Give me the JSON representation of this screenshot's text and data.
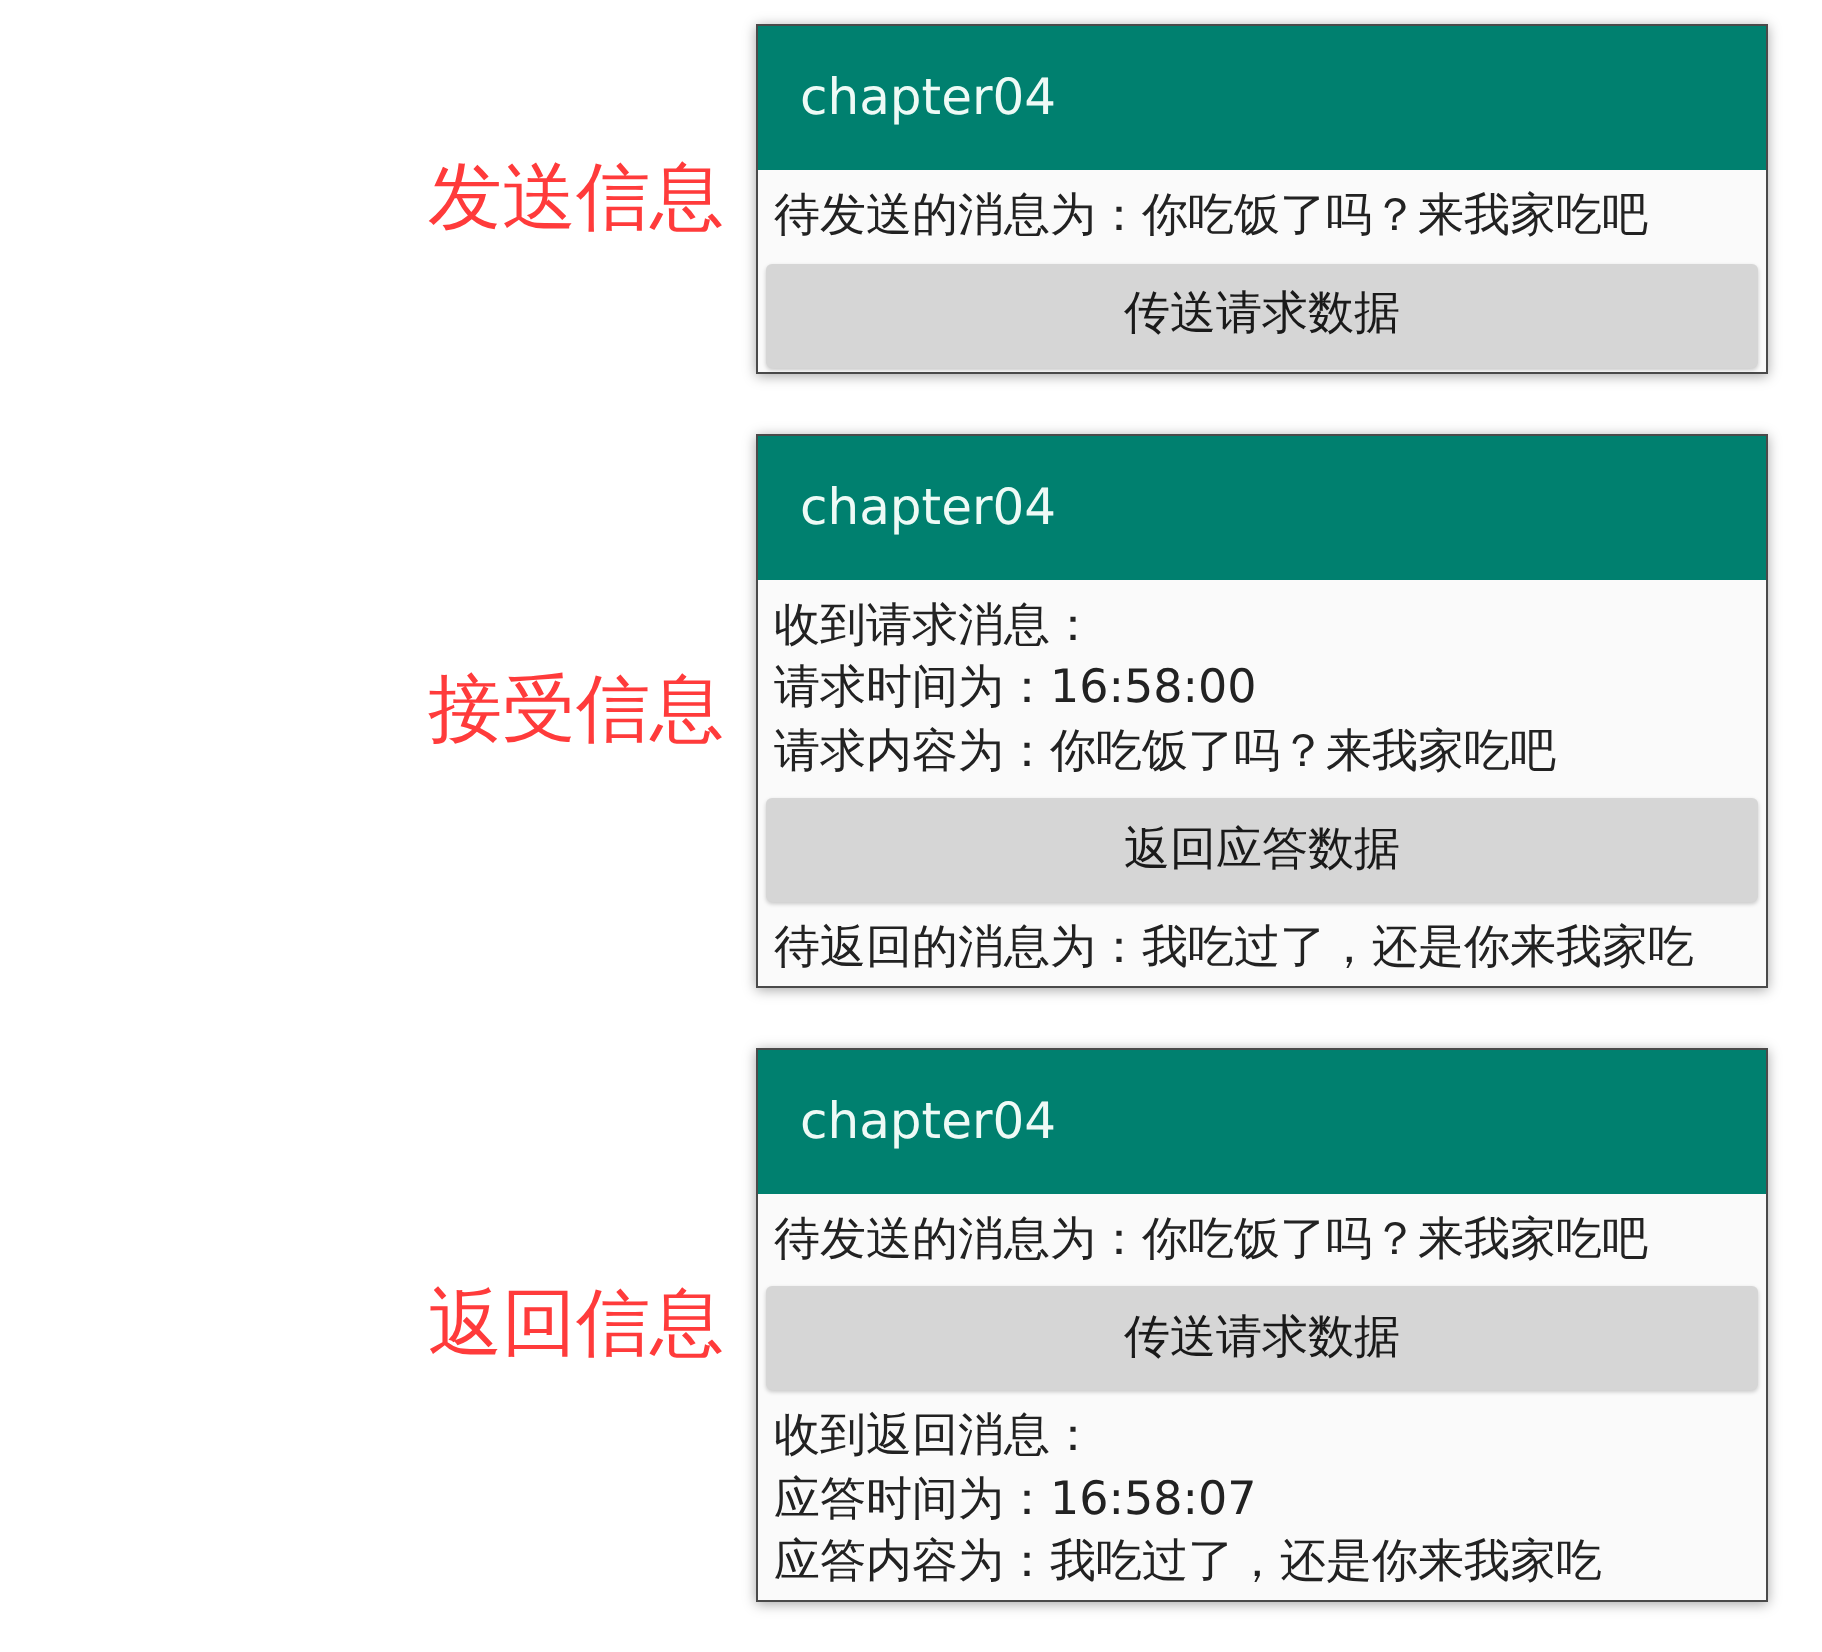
{
  "sections": [
    {
      "label": "发送信息",
      "screen": {
        "title": "chapter04",
        "items": [
          {
            "kind": "text",
            "text": "待发送的消息为：你吃饭了吗？来我家吃吧"
          },
          {
            "kind": "button",
            "text": "传送请求数据"
          }
        ]
      }
    },
    {
      "label": "接受信息",
      "screen": {
        "title": "chapter04",
        "items": [
          {
            "kind": "text",
            "text": "收到请求消息："
          },
          {
            "kind": "text",
            "text": "请求时间为：16:58:00"
          },
          {
            "kind": "text",
            "text": "请求内容为：你吃饭了吗？来我家吃吧"
          },
          {
            "kind": "button",
            "text": "返回应答数据"
          },
          {
            "kind": "text",
            "text": "待返回的消息为：我吃过了，还是你来我家吃"
          }
        ]
      }
    },
    {
      "label": "返回信息",
      "screen": {
        "title": "chapter04",
        "items": [
          {
            "kind": "text",
            "text": "待发送的消息为：你吃饭了吗？来我家吃吧"
          },
          {
            "kind": "button",
            "text": "传送请求数据"
          },
          {
            "kind": "text",
            "text": "收到返回消息："
          },
          {
            "kind": "text",
            "text": "应答时间为：16:58:07"
          },
          {
            "kind": "text",
            "text": "应答内容为：我吃过了，还是你来我家吃"
          }
        ]
      }
    }
  ]
}
